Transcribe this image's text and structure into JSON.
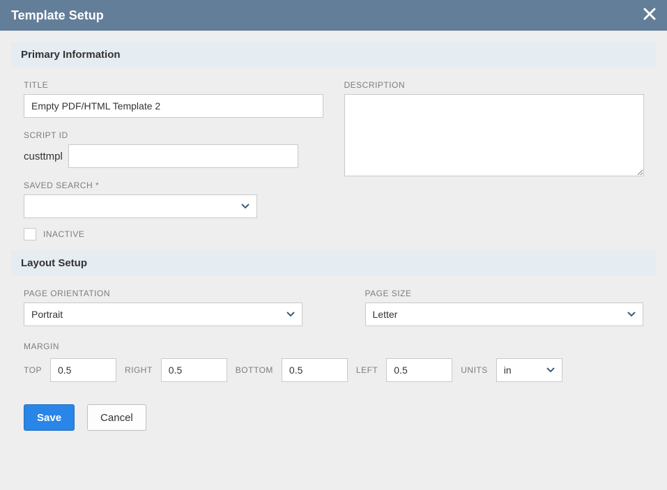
{
  "dialog": {
    "title": "Template Setup",
    "close_icon": "close"
  },
  "sections": {
    "primary": {
      "header": "Primary Information",
      "title_label": "TITLE",
      "title_value": "Empty PDF/HTML Template 2",
      "script_id_label": "SCRIPT ID",
      "script_id_prefix": "custtmpl",
      "script_id_value": "",
      "saved_search_label": "SAVED SEARCH *",
      "saved_search_value": "",
      "inactive_label": "INACTIVE",
      "inactive_checked": false,
      "description_label": "DESCRIPTION",
      "description_value": ""
    },
    "layout": {
      "header": "Layout Setup",
      "orientation_label": "PAGE ORIENTATION",
      "orientation_value": "Portrait",
      "page_size_label": "PAGE SIZE",
      "page_size_value": "Letter",
      "margin_label": "MARGIN",
      "top_label": "TOP",
      "top_value": "0.5",
      "right_label": "RIGHT",
      "right_value": "0.5",
      "bottom_label": "BOTTOM",
      "bottom_value": "0.5",
      "left_label": "LEFT",
      "left_value": "0.5",
      "units_label": "UNITS",
      "units_value": "in"
    }
  },
  "buttons": {
    "save": "Save",
    "cancel": "Cancel"
  }
}
